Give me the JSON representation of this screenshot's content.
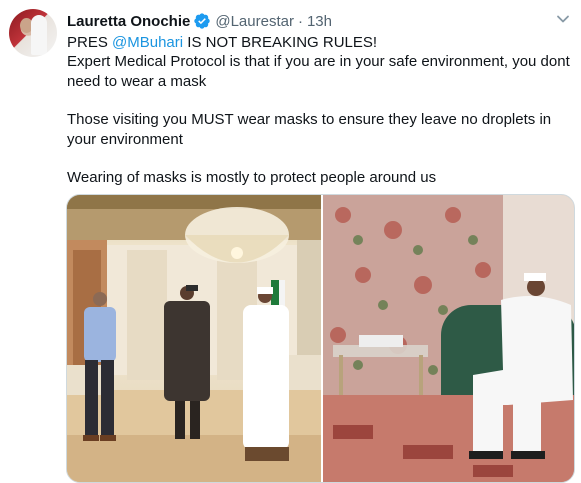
{
  "tweet": {
    "author_name": "Lauretta Onochie",
    "handle": "@Laurestar",
    "separator": "·",
    "time": "13h",
    "verified": true,
    "lines": {
      "l1_prefix": "PRES ",
      "l1_mention": "@MBuhari",
      "l1_suffix": " IS NOT BREAKING RULES!",
      "l2": "Expert Medical Protocol is that if you are in your safe environment, you dont need to wear a mask",
      "l3": "Those visiting you MUST wear masks to ensure they leave no droplets in your environment",
      "l4": "Wearing of masks is mostly to protect people around us"
    }
  },
  "colors": {
    "accent": "#1b95e0",
    "verified_badge": "#1d9bf0",
    "secondary_text": "#536471",
    "primary_text": "#0f1419"
  },
  "icons": {
    "verified": "verified-badge-icon",
    "menu": "chevron-down-icon"
  }
}
